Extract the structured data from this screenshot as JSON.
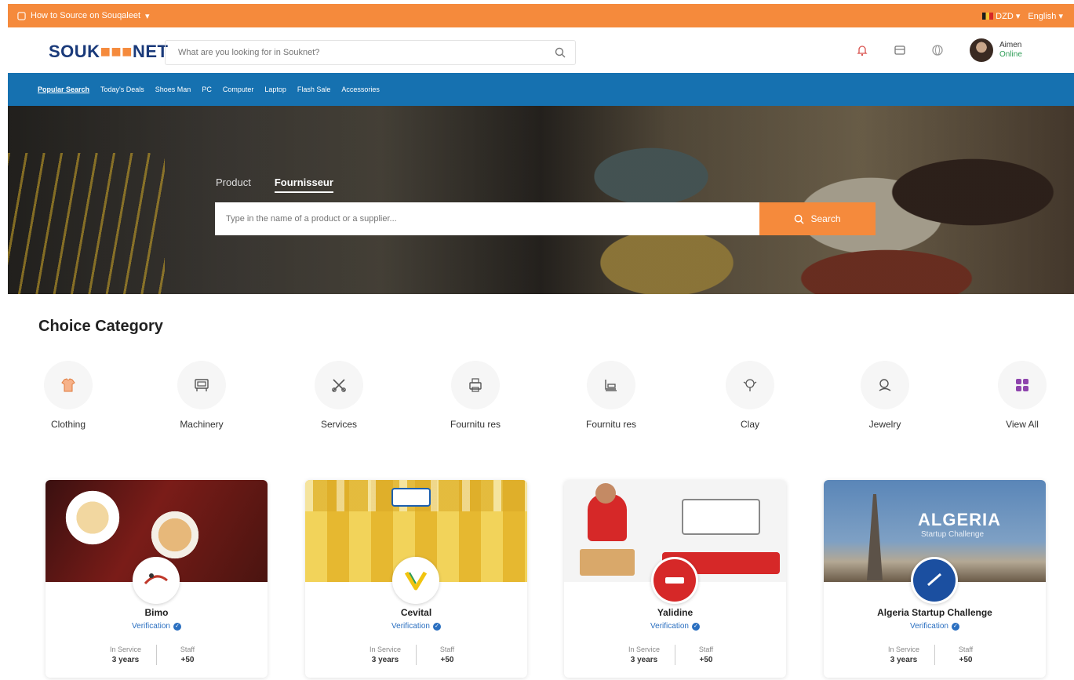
{
  "topbar": {
    "left_text": "How to Source on Souqaleet",
    "currency": "DZD",
    "language": "English"
  },
  "header": {
    "logo_left": "SOUK",
    "logo_mid": "■■■",
    "logo_right": "NET",
    "search_placeholder": "What are you looking for in Souknet?",
    "user_name": "Aimen",
    "user_status": "Online"
  },
  "nav": {
    "items": [
      "Popular Search",
      "Today's Deals",
      "Shoes Man",
      "PC",
      "Computer",
      "Laptop",
      "Flash Sale",
      "Accessories"
    ]
  },
  "hero": {
    "tab_product": "Product",
    "tab_supplier": "Fournisseur",
    "search_placeholder": "Type in the name of a product or a supplier...",
    "search_button": "Search"
  },
  "categories": {
    "title": "Choice Category",
    "items": [
      {
        "label": "Clothing",
        "icon": "shirt-icon"
      },
      {
        "label": "Machinery",
        "icon": "machine-icon"
      },
      {
        "label": "Services",
        "icon": "tools-icon"
      },
      {
        "label": "Fournitu res",
        "icon": "printer-icon"
      },
      {
        "label": "Fournitu res",
        "icon": "furniture-icon"
      },
      {
        "label": "Clay",
        "icon": "clay-icon"
      },
      {
        "label": "Jewelry",
        "icon": "jewelry-icon"
      },
      {
        "label": "View All",
        "icon": "grid-icon"
      }
    ]
  },
  "cards": [
    {
      "name": "Bimo",
      "verification": "Verification",
      "service_label": "In Service",
      "service_value": "3 years",
      "staff_label": "Staff",
      "staff_value": "+50"
    },
    {
      "name": "Cevital",
      "verification": "Verification",
      "service_label": "In Service",
      "service_value": "3 years",
      "staff_label": "Staff",
      "staff_value": "+50"
    },
    {
      "name": "Yalidine",
      "verification": "Verification",
      "service_label": "In Service",
      "service_value": "3 years",
      "staff_label": "Staff",
      "staff_value": "+50"
    },
    {
      "name": "Algeria Startup Challenge",
      "verification": "Verification",
      "service_label": "In Service",
      "service_value": "3 years",
      "staff_label": "Staff",
      "staff_value": "+50"
    }
  ],
  "card_banners": {
    "algeria_title": "ALGERIA",
    "algeria_sub": "Startup Challenge"
  },
  "colors": {
    "accent_orange": "#f58a3c",
    "nav_blue": "#1671b0",
    "verify_blue": "#2a6fc0"
  }
}
